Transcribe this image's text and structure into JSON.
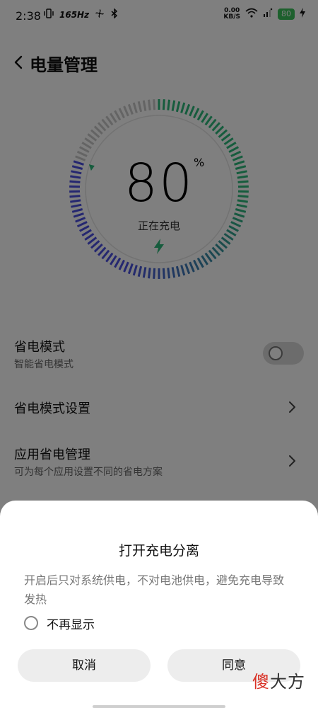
{
  "status_bar": {
    "time": "2:38",
    "refresh_rate": "165Hz",
    "net_speed_value": "0.00",
    "net_speed_unit": "KB/S",
    "battery_level": "80"
  },
  "header": {
    "title": "电量管理"
  },
  "gauge": {
    "level": 80,
    "percent_value": "80",
    "percent_sign": "%",
    "status_text": "正在充电",
    "colors": {
      "green": "#2db87a",
      "blue": "#4a4fe0",
      "inactive": "#c8c8c8"
    }
  },
  "settings": {
    "power_save_mode": {
      "title": "省电模式",
      "subtitle": "智能省电模式",
      "enabled": false
    },
    "power_save_settings": {
      "title": "省电模式设置"
    },
    "app_power_management": {
      "title": "应用省电管理",
      "subtitle": "可为每个应用设置不同的省电方案"
    }
  },
  "dialog": {
    "title": "打开充电分离",
    "message": "开启后只对系统供电，不对电池供电，避免充电导致发热",
    "dont_show_again": "不再显示",
    "cancel": "取消",
    "agree": "同意"
  },
  "watermark": {
    "first_char": "傻",
    "rest": "大方"
  }
}
